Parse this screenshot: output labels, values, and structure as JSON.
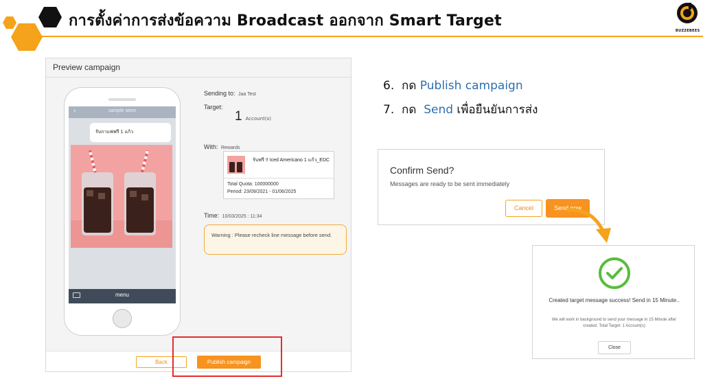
{
  "header": {
    "title": "การตั้งค่าการส่งข้อความ Broadcast ออกจาก Smart Target",
    "brand": "BUZZEBEES",
    "colors": {
      "accent": "#f5a31a",
      "hex_dark": "#111111"
    }
  },
  "preview": {
    "title": "Preview campaign",
    "phone": {
      "store": "sample store",
      "message": "รับกาแฟฟรี 1 แก้ว",
      "menu": "menu"
    },
    "sending_to_label": "Sending to:",
    "sending_to_value": "Jaa Test",
    "target_label": "Target:",
    "target_count": "1",
    "target_unit": "Account(s)",
    "with_label": "With:",
    "with_value": "Rewards",
    "reward": {
      "name": "รับฟรี !! Iced Americano 1 แก้ว_EDC",
      "quota": "Total Quota: 100000000",
      "period": "Period: 23/09/2021 - 01/06/2025"
    },
    "time_label": "Time:",
    "time_value": "10/03/2025 : 11:34",
    "warning": "Warning : Please recheck line message before send.",
    "back_button": "Back",
    "publish_button": "Publish campaign"
  },
  "steps": [
    {
      "num": "6.",
      "prefix": "กด ",
      "highlight": "Publish campaign",
      "suffix": ""
    },
    {
      "num": "7.",
      "prefix": "กด  ",
      "highlight": "Send",
      "suffix": " เพื่อยืนยันการส่ง"
    }
  ],
  "confirm": {
    "title": "Confirm Send?",
    "message": "Messages are ready to be sent immediately",
    "cancel": "Cancel",
    "send": "Send now"
  },
  "success": {
    "title": "Created target message success! Send in 15 Minute..",
    "subtitle": "We will work in background to send your message in 15 Minute after created. Total Target: 1 Account(s)",
    "close": "Close"
  }
}
